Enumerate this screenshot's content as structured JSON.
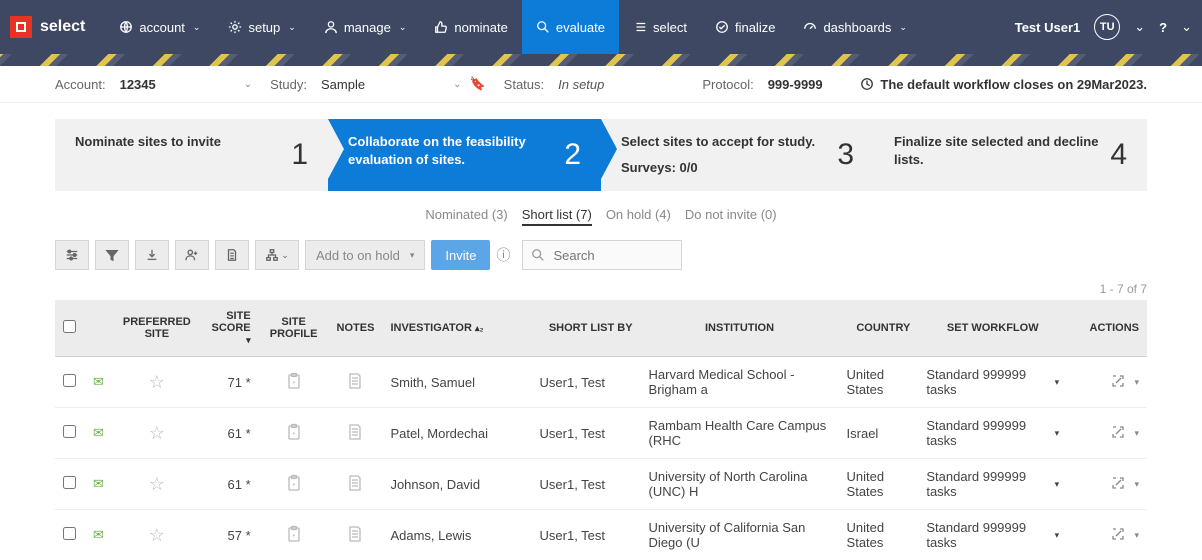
{
  "brand": "select",
  "nav": {
    "account": "account",
    "setup": "setup",
    "manage": "manage",
    "nominate": "nominate",
    "evaluate": "evaluate",
    "select": "select",
    "finalize": "finalize",
    "dashboards": "dashboards"
  },
  "user": {
    "name": "Test User1",
    "initials": "TU"
  },
  "context": {
    "account_label": "Account:",
    "account_value": "12345",
    "study_label": "Study:",
    "study_value": "Sample",
    "status_label": "Status:",
    "status_value": "In setup",
    "protocol_label": "Protocol:",
    "protocol_value": "999-9999",
    "warning": "The default workflow closes on 29Mar2023."
  },
  "workflow": {
    "step1": {
      "text": "Nominate sites to invite",
      "num": "1"
    },
    "step2": {
      "text": "Collaborate on the feasibility evaluation of sites.",
      "num": "2"
    },
    "step3": {
      "text": "Select sites to accept for study.",
      "sub": "Surveys: 0/0",
      "num": "3"
    },
    "step4": {
      "text": "Finalize site selected and decline lists.",
      "num": "4"
    }
  },
  "subtabs": {
    "nominated": "Nominated (3)",
    "shortlist": "Short list (7)",
    "onhold": "On hold (4)",
    "donotinvite": "Do not invite (0)"
  },
  "toolbar": {
    "add_to_onhold": "Add to on hold",
    "invite": "Invite",
    "search_placeholder": "Search"
  },
  "pager": "1 - 7 of 7",
  "columns": {
    "preferred": "PREFERRED SITE",
    "score": "SITE SCORE",
    "profile": "SITE PROFILE",
    "notes": "NOTES",
    "investigator": "INVESTIGATOR",
    "shortlistby": "SHORT LIST BY",
    "institution": "INSTITUTION",
    "country": "COUNTRY",
    "workflow": "SET WORKFLOW",
    "actions": "ACTIONS"
  },
  "rows": [
    {
      "score": "71 *",
      "investigator": "Smith, Samuel",
      "shortlistby": "User1, Test",
      "institution": "Harvard Medical School - Brigham a",
      "country": "United States",
      "workflow": "Standard 999999 tasks"
    },
    {
      "score": "61 *",
      "investigator": "Patel, Mordechai",
      "shortlistby": "User1, Test",
      "institution": "Rambam Health Care Campus (RHC",
      "country": "Israel",
      "workflow": "Standard 999999 tasks"
    },
    {
      "score": "61 *",
      "investigator": "Johnson, David",
      "shortlistby": "User1, Test",
      "institution": "University of North Carolina (UNC) H",
      "country": "United States",
      "workflow": "Standard 999999 tasks"
    },
    {
      "score": "57 *",
      "investigator": "Adams, Lewis",
      "shortlistby": "User1, Test",
      "institution": "University of California San Diego (U",
      "country": "United States",
      "workflow": "Standard 999999 tasks"
    }
  ]
}
